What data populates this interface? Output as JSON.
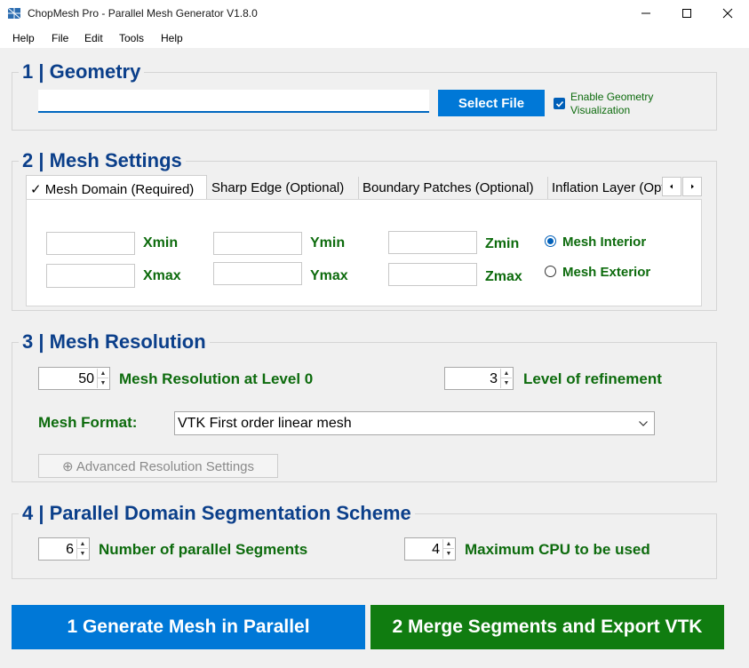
{
  "window": {
    "title": "ChopMesh Pro - Parallel Mesh Generator V1.8.0",
    "icon": "app-logo-icon"
  },
  "menu": [
    "Help",
    "File",
    "Edit",
    "Tools",
    "Help"
  ],
  "geometry": {
    "title": "1 | Geometry",
    "file_path": "",
    "select_file_label": "Select File",
    "enable_visualization_label": "Enable Geometry Visualization",
    "enable_visualization_checked": true
  },
  "mesh_settings": {
    "title": "2 | Mesh Settings",
    "tabs": [
      "✓ Mesh Domain (Required)",
      "Sharp Edge (Optional)",
      "Boundary Patches (Optional)",
      "Inflation Layer (Optional)"
    ],
    "active_tab": 0,
    "labels": {
      "xmin": "Xmin",
      "ymin": "Ymin",
      "zmin": "Zmin",
      "xmax": "Xmax",
      "ymax": "Ymax",
      "zmax": "Zmax"
    },
    "values": {
      "xmin": "",
      "ymin": "",
      "zmin": "",
      "xmax": "",
      "ymax": "",
      "zmax": ""
    },
    "radio": {
      "interior_label": "Mesh Interior",
      "exterior_label": "Mesh Exterior",
      "selected": "interior"
    }
  },
  "mesh_resolution": {
    "title": "3 | Mesh Resolution",
    "level0_value": "50",
    "level0_label": "Mesh Resolution at Level 0",
    "refinement_value": "3",
    "refinement_label": "Level of refinement",
    "format_label": "Mesh Format:",
    "format_value": "VTK First order linear mesh",
    "advanced_label": "⊕ Advanced Resolution Settings"
  },
  "segmentation": {
    "title": "4 | Parallel Domain Segmentation Scheme",
    "segments_value": "6",
    "segments_label": "Number of parallel Segments",
    "cpu_value": "4",
    "cpu_label": "Maximum CPU to be used"
  },
  "actions": {
    "generate_label": "1 Generate Mesh in Parallel",
    "merge_label": "2 Merge Segments and Export VTK"
  },
  "colors": {
    "accent_blue": "#0078d7",
    "action_green": "#107c10",
    "heading_blue": "#0b3f8a",
    "label_green": "#0d6b0d"
  }
}
